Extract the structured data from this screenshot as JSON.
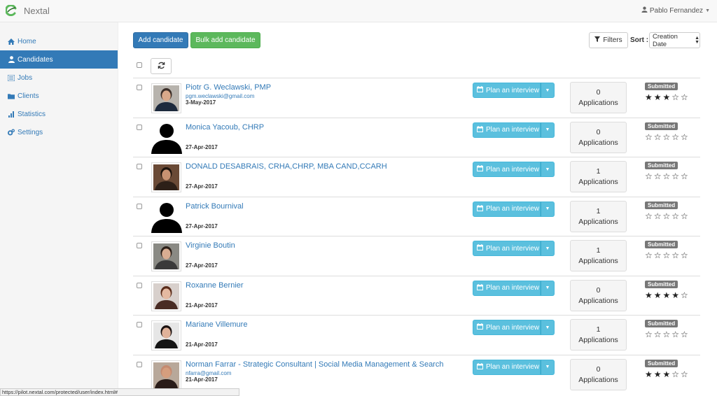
{
  "app": {
    "title": "Nextal",
    "user_name": "Pablo Fernandez"
  },
  "sidebar": {
    "items": [
      {
        "label": "Home",
        "icon": "home-icon"
      },
      {
        "label": "Candidates",
        "icon": "user-icon",
        "active": true
      },
      {
        "label": "Jobs",
        "icon": "list-icon"
      },
      {
        "label": "Clients",
        "icon": "folder-icon"
      },
      {
        "label": "Statistics",
        "icon": "bar-chart-icon"
      },
      {
        "label": "Settings",
        "icon": "gears-icon"
      }
    ]
  },
  "toolbar": {
    "add_label": "Add candidate",
    "bulk_label": "Bulk add candidate",
    "filters_label": "Filters",
    "sort_label": "Sort :",
    "sort_value": "Creation Date"
  },
  "colors": {
    "primary": "#337ab7",
    "success": "#5cb85c",
    "info": "#5bc0de",
    "badge": "#777777"
  },
  "candidates": [
    {
      "name": "Piotr G. Weclawski, PMP",
      "email": "pgm.weclawski@gmail.com",
      "date": "3-May-2017",
      "plan_label": "Plan an interview",
      "applications_count": "0",
      "applications_label": "Applications",
      "status": "Submitted",
      "rating": 3,
      "stars": "★★★☆☆",
      "photo": "photo"
    },
    {
      "name": "Monica Yacoub, CHRP",
      "email": "",
      "date": "27-Apr-2017",
      "plan_label": "Plan an interview",
      "applications_count": "0",
      "applications_label": "Applications",
      "status": "Submitted",
      "rating": 0,
      "stars": "☆☆☆☆☆",
      "photo": "silhouette"
    },
    {
      "name": "DONALD DESABRAIS, CRHA,CHRP, MBA CAND,CCARH",
      "email": "",
      "date": "27-Apr-2017",
      "plan_label": "Plan an interview",
      "applications_count": "1",
      "applications_label": "Applications",
      "status": "Submitted",
      "rating": 0,
      "stars": "☆☆☆☆☆",
      "photo": "photo"
    },
    {
      "name": "Patrick Bournival",
      "email": "",
      "date": "27-Apr-2017",
      "plan_label": "Plan an interview",
      "applications_count": "1",
      "applications_label": "Applications",
      "status": "Submitted",
      "rating": 0,
      "stars": "☆☆☆☆☆",
      "photo": "silhouette"
    },
    {
      "name": "Virginie Boutin",
      "email": "",
      "date": "27-Apr-2017",
      "plan_label": "Plan an interview",
      "applications_count": "1",
      "applications_label": "Applications",
      "status": "Submitted",
      "rating": 0,
      "stars": "☆☆☆☆☆",
      "photo": "photo"
    },
    {
      "name": "Roxanne Bernier",
      "email": "",
      "date": "21-Apr-2017",
      "plan_label": "Plan an interview",
      "applications_count": "0",
      "applications_label": "Applications",
      "status": "Submitted",
      "rating": 4,
      "stars": "★★★★☆",
      "photo": "photo"
    },
    {
      "name": "Mariane Villemure",
      "email": "",
      "date": "21-Apr-2017",
      "plan_label": "Plan an interview",
      "applications_count": "1",
      "applications_label": "Applications",
      "status": "Submitted",
      "rating": 0,
      "stars": "☆☆☆☆☆",
      "photo": "photo"
    },
    {
      "name": "Norman Farrar - Strategic Consultant | Social Media Management & Search",
      "email": "nfarra@gmail.com",
      "date": "21-Apr-2017",
      "plan_label": "Plan an interview",
      "applications_count": "0",
      "applications_label": "Applications",
      "status": "Submitted",
      "rating": 3,
      "stars": "★★★☆☆",
      "photo": "photo"
    }
  ],
  "statusbar": {
    "url": "https://pilot.nextal.com/protected/user/index.html#"
  }
}
